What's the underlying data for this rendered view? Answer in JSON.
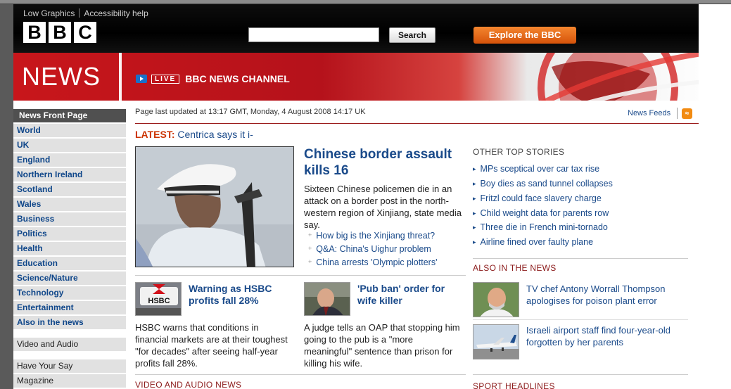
{
  "header": {
    "util_links": [
      "Low Graphics",
      "Accessibility help"
    ],
    "logo_letters": [
      "B",
      "B",
      "C"
    ],
    "search_button": "Search",
    "explore_button": "Explore the BBC"
  },
  "banner": {
    "title": "NEWS",
    "live_label": "LIVE",
    "channel": "BBC NEWS CHANNEL"
  },
  "nav": {
    "items": [
      "News Front Page",
      "World",
      "UK",
      "England",
      "Northern Ireland",
      "Scotland",
      "Wales",
      "Business",
      "Politics",
      "Health",
      "Education",
      "Science/Nature",
      "Technology",
      "Entertainment",
      "Also in the news"
    ],
    "secondary": [
      "Video and Audio"
    ],
    "tertiary": [
      "Have Your Say",
      "Magazine"
    ]
  },
  "page": {
    "updated": "Page last updated at 13:17 GMT, Monday, 4 August 2008 14:17 UK",
    "feeds": "News Feeds",
    "latest_label": "LATEST:",
    "latest_text": "Centrica says it i-"
  },
  "top_story": {
    "headline": "Chinese border assault kills 16",
    "summary": "Sixteen Chinese policemen die in an attack on a border post in the north-western region of Xinjiang, state media say.",
    "related": [
      "How big is the Xinjiang threat?",
      "Q&A: China's Uighur problem",
      "China arrests 'Olympic plotters'"
    ]
  },
  "stories": [
    {
      "headline": "Warning as HSBC profits fall 28%",
      "summary": "HSBC warns that conditions in financial markets are at their toughest \"for decades\" after seeing half-year profits fall 28%.",
      "thumb_text": "HSBC"
    },
    {
      "headline": "'Pub ban' order for wife killer",
      "summary": "A judge tells an OAP that stopping him going to the pub is a \"more meaningful\" sentence than prison for killing his wife."
    }
  ],
  "other_top": {
    "title": "OTHER TOP STORIES",
    "items": [
      "MPs sceptical over car tax rise",
      "Boy dies as sand tunnel collapses",
      "Fritzl could face slavery charge",
      "Child weight data for parents row",
      "Three die in French mini-tornado",
      "Airline fined over faulty plane"
    ]
  },
  "also": {
    "title": "ALSO IN THE NEWS",
    "items": [
      "TV chef Antony Worrall Thompson apologises for poison plant error",
      "Israeli airport staff find four-year-old forgotten by her parents"
    ]
  },
  "sections": {
    "video": "VIDEO AND AUDIO NEWS",
    "sport": "SPORT HEADLINES"
  },
  "colors": {
    "news_red": "#c8161b",
    "link_blue": "#1a4a8a",
    "explore_orange": "#e86a1c"
  }
}
